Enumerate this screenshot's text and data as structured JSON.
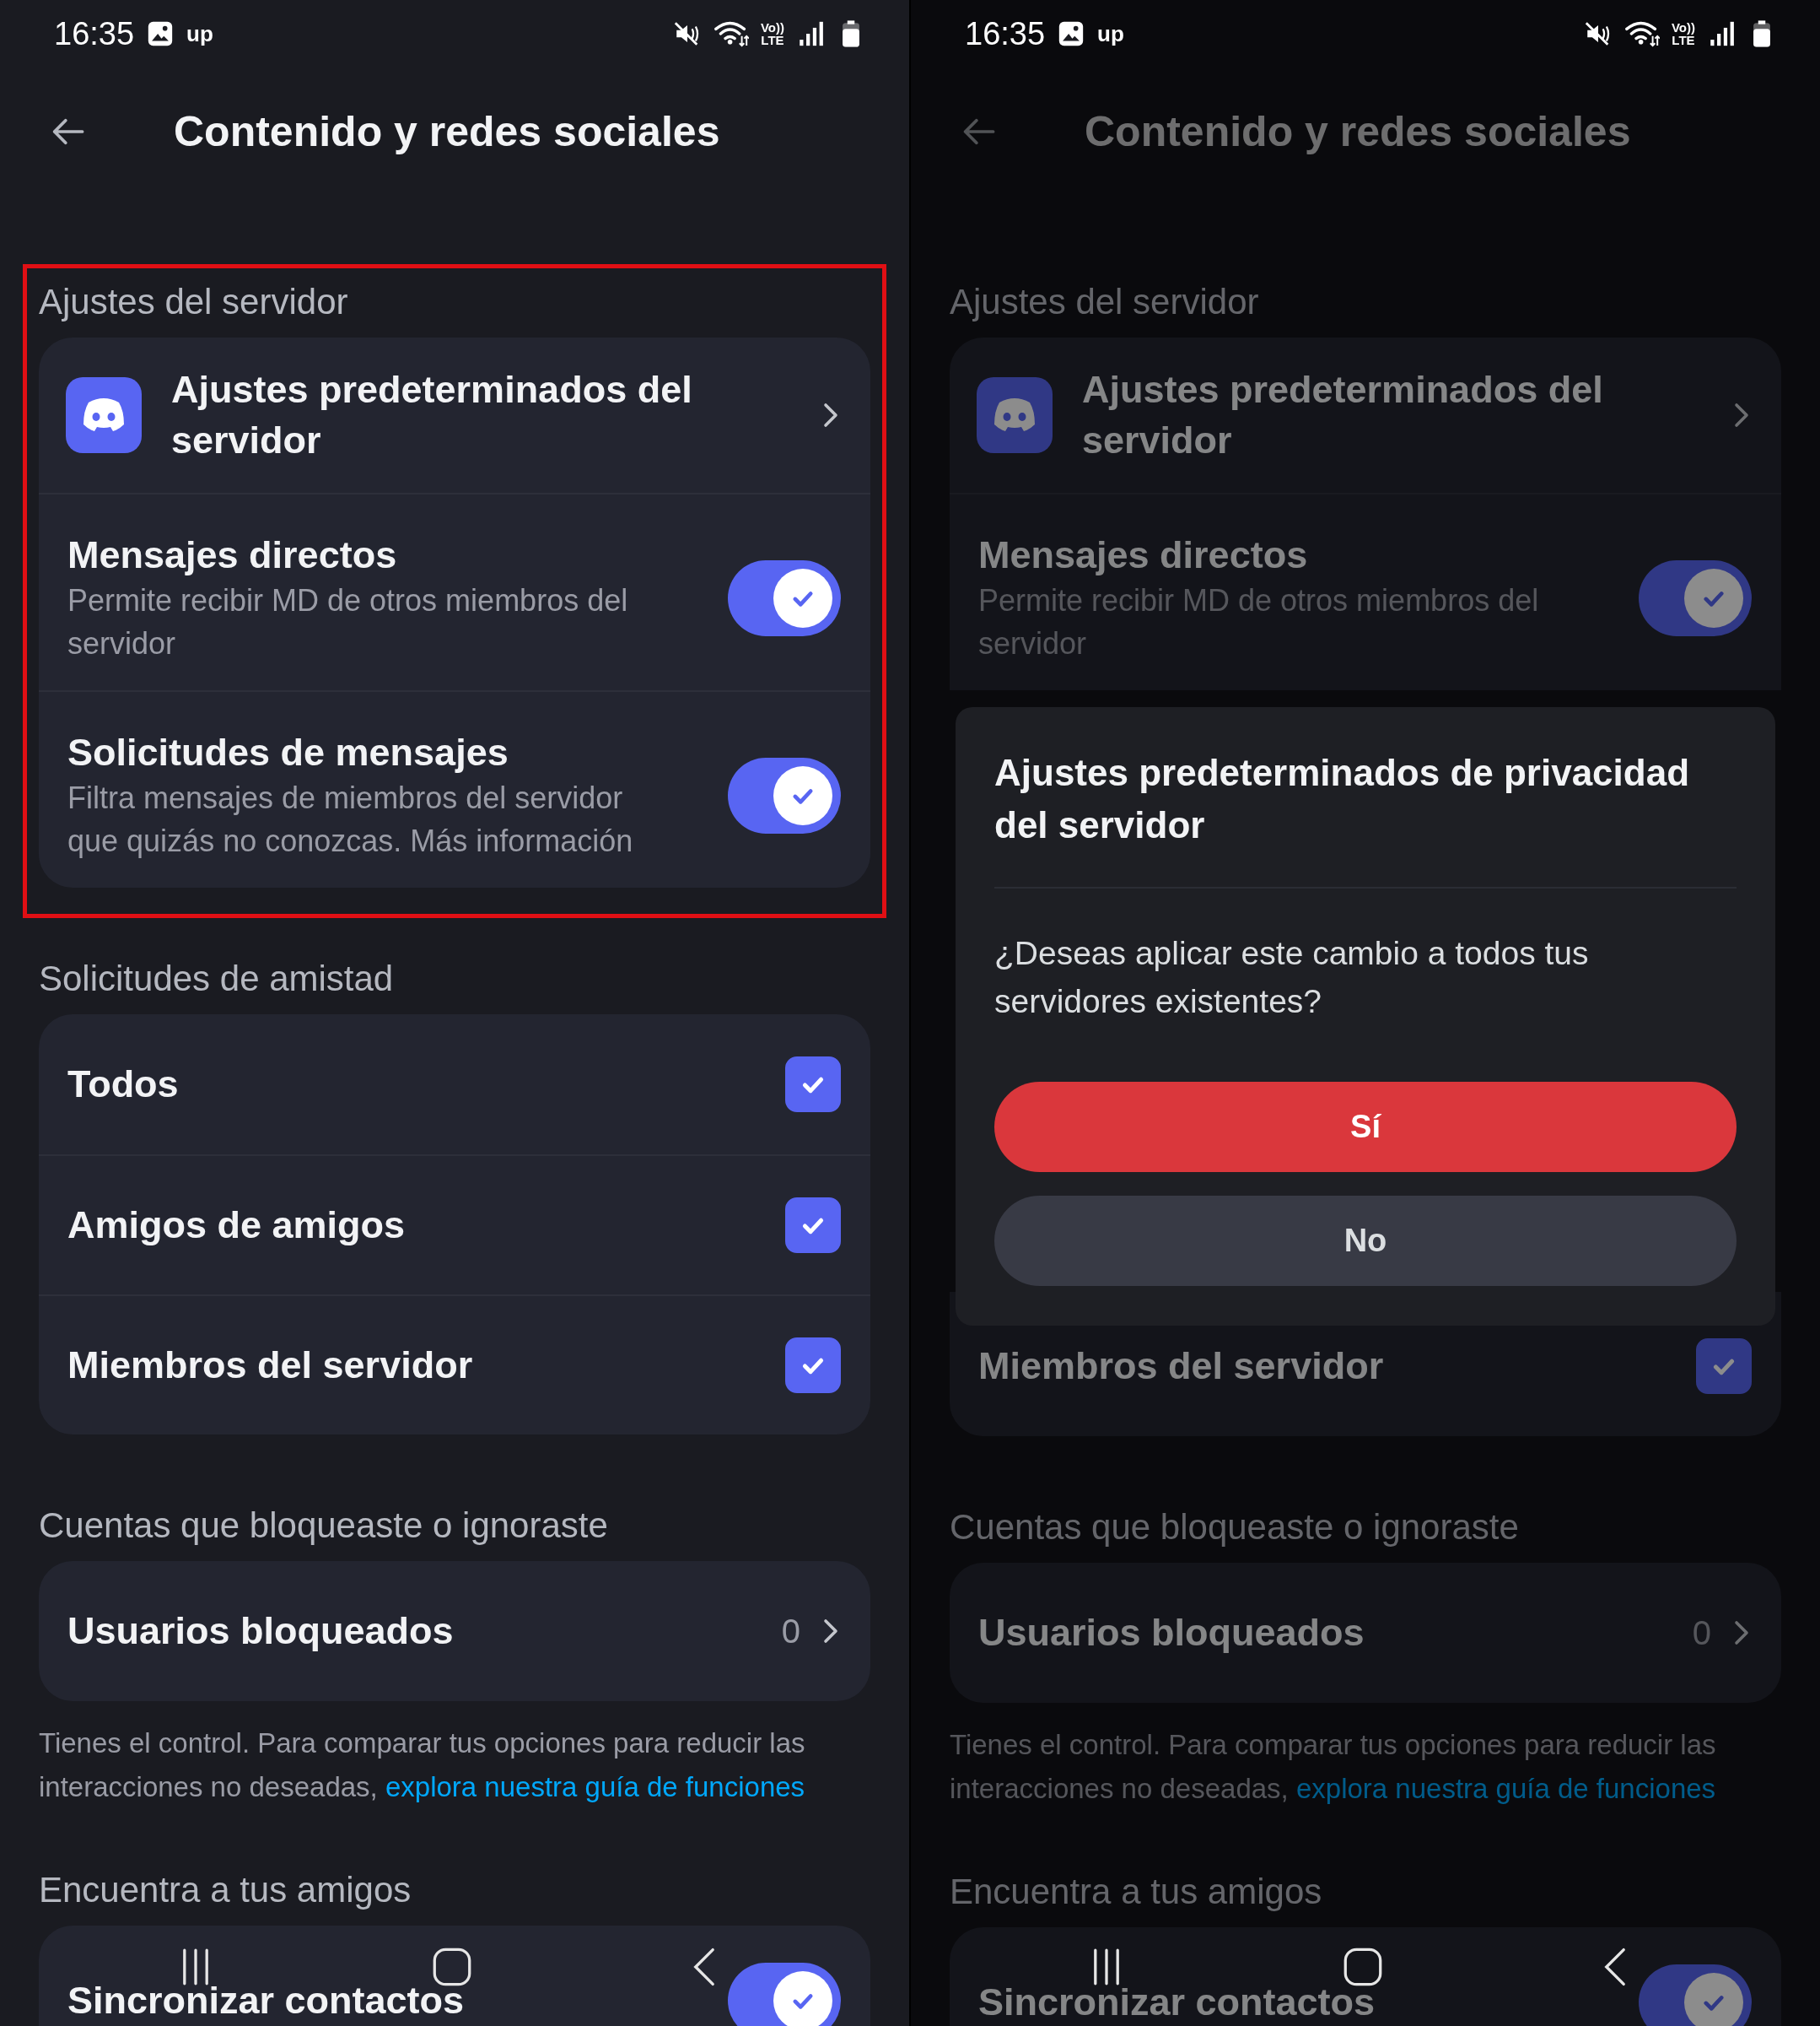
{
  "screens": [
    {
      "dimmed": false,
      "status_bar": {
        "time": "16:35",
        "app_badge": "up",
        "volte": "Vo))",
        "network": "LTE"
      },
      "header": {
        "title": "Contenido y redes sociales"
      },
      "blocks": [
        {
          "kind": "section",
          "label": "Ajustes del servidor",
          "highlighted": true,
          "rows": [
            {
              "kind": "app_link",
              "title": "Ajustes predeterminados del servidor"
            },
            {
              "kind": "toggle",
              "title": "Mensajes directos",
              "subtitle": "Permite recibir MD de otros miembros del servidor",
              "on": true
            },
            {
              "kind": "toggle",
              "title": "Solicitudes de mensajes",
              "subtitle": "Filtra mensajes de miembros del servidor que quizás no conozcas. Más información",
              "on": true
            }
          ]
        },
        {
          "kind": "section",
          "label": "Solicitudes de amistad",
          "highlighted": false,
          "rows": [
            {
              "kind": "checkbox",
              "title": "Todos",
              "checked": true
            },
            {
              "kind": "checkbox",
              "title": "Amigos de amigos",
              "checked": true
            },
            {
              "kind": "checkbox",
              "title": "Miembros del servidor",
              "checked": true
            }
          ]
        },
        {
          "kind": "section",
          "label": "Cuentas que bloqueaste o ignoraste",
          "highlighted": false,
          "rows": [
            {
              "kind": "nav",
              "title": "Usuarios bloqueados",
              "count": "0"
            }
          ],
          "footer": {
            "text": "Tienes el control. Para comparar tus opciones para reducir las interacciones no deseadas, ",
            "link": "explora nuestra guía de funciones"
          }
        },
        {
          "kind": "section",
          "label": "Encuentra a tus amigos",
          "highlighted": false,
          "rows": [
            {
              "kind": "toggle",
              "title": "Sincronizar contactos",
              "on": true
            }
          ]
        }
      ]
    },
    {
      "dimmed": true,
      "status_bar": {
        "time": "16:35",
        "app_badge": "up",
        "volte": "Vo))",
        "network": "LTE"
      },
      "header": {
        "title": "Contenido y redes sociales"
      },
      "blocks": [
        {
          "kind": "section",
          "label": "Ajustes del servidor",
          "highlighted": false,
          "rows": [
            {
              "kind": "app_link",
              "title": "Ajustes predeterminados del servidor"
            },
            {
              "kind": "toggle",
              "title": "Mensajes directos",
              "subtitle": "Permite recibir MD de otros miembros del servidor",
              "on": true
            }
          ]
        },
        {
          "kind": "dialog",
          "title": "Ajustes predeterminados de privacidad del servidor",
          "message": "¿Deseas aplicar este cambio a todos tus servidores existentes?",
          "buttons": [
            {
              "label": "Sí",
              "kind": "danger"
            },
            {
              "label": "No",
              "kind": "secondary"
            }
          ]
        },
        {
          "kind": "section",
          "highlighted": false,
          "rows": [
            {
              "kind": "checkbox",
              "title": "Miembros del servidor",
              "checked": true
            }
          ]
        },
        {
          "kind": "section",
          "label": "Cuentas que bloqueaste o ignoraste",
          "highlighted": false,
          "rows": [
            {
              "kind": "nav",
              "title": "Usuarios bloqueados",
              "count": "0"
            }
          ],
          "footer": {
            "text": "Tienes el control. Para comparar tus opciones para reducir las interacciones no deseadas, ",
            "link": "explora nuestra guía de funciones"
          }
        },
        {
          "kind": "section",
          "label": "Encuentra a tus amigos",
          "highlighted": false,
          "rows": [
            {
              "kind": "toggle",
              "title": "Sincronizar contactos",
              "on": true
            }
          ]
        }
      ]
    }
  ]
}
